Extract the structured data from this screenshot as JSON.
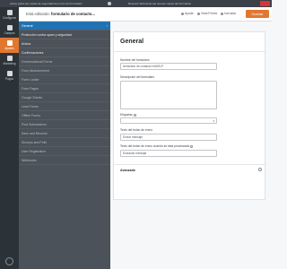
{
  "topbar": {
    "notice_left": "Active gratis las copias de seguridad del envío del formulario",
    "notice_right": "Recevoir fácilmente las nuevas copias del formulario"
  },
  "sidebar": {
    "items": [
      {
        "label": "Configurar",
        "icon": "gear-icon"
      },
      {
        "label": "Campos",
        "icon": "fields-icon"
      },
      {
        "label": "Ajustes",
        "icon": "sliders-icon"
      },
      {
        "label": "Marketing",
        "icon": "megaphone-icon"
      },
      {
        "label": "Pagos",
        "icon": "dollar-icon"
      }
    ],
    "active_index": 2
  },
  "header": {
    "editing_prefix": "Está editando:",
    "form_name": "formulario de contacto...",
    "help_label": "Ayuda",
    "preview_label": "Vista Previa",
    "embed_label": "Incrustar",
    "save_label": "Guardar"
  },
  "subnav": {
    "items": [
      {
        "label": "General",
        "active": true
      },
      {
        "label": "Protección contra spam y seguridad",
        "main": true
      },
      {
        "label": "Avisos",
        "main": true
      },
      {
        "label": "Confirmaciones",
        "main": true
      },
      {
        "label": "Conversational Forms"
      },
      {
        "label": "Form Abandonment"
      },
      {
        "label": "Form Locker"
      },
      {
        "label": "Form Pages"
      },
      {
        "label": "Google Sheets"
      },
      {
        "label": "Lead Forms"
      },
      {
        "label": "Offline Forms"
      },
      {
        "label": "Post Submissions"
      },
      {
        "label": "Save and Resume"
      },
      {
        "label": "Surveys and Polls"
      },
      {
        "label": "User Registration"
      },
      {
        "label": "Webhooks"
      }
    ]
  },
  "panel": {
    "title": "General",
    "form_name_label": "Nombre del formulario",
    "form_name_value": "formulario de contacto NUKELP",
    "description_label": "Descripción del formulario",
    "tags_label": "Etiquetas",
    "submit_text_label": "Texto del botón de envío",
    "submit_text_value": "Enviar mensaje",
    "processing_text_label": "Texto del botón de envío cuando se está procesando",
    "processing_text_value": "Enviando mensaje",
    "advanced_label": "Avanzado"
  }
}
